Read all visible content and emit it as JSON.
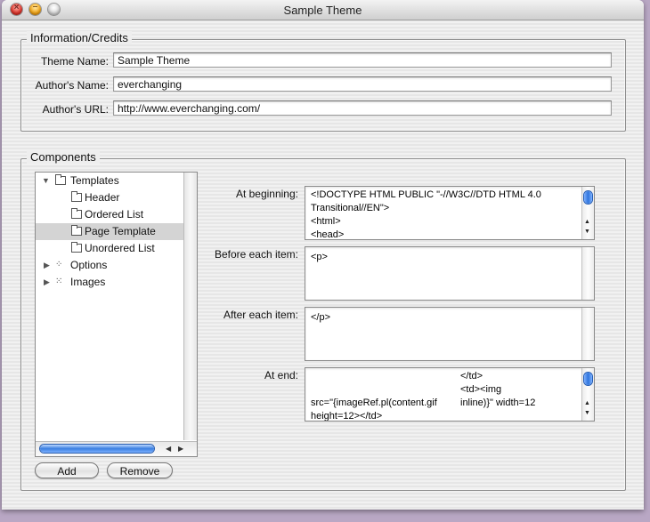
{
  "window": {
    "title": "Sample Theme"
  },
  "info": {
    "title": "Information/Credits",
    "theme_name_label": "Theme Name:",
    "theme_name_value": "Sample Theme",
    "author_name_label": "Author's Name:",
    "author_name_value": "everchanging",
    "author_url_label": "Author's URL:",
    "author_url_value": "http://www.everchanging.com/"
  },
  "components": {
    "title": "Components",
    "tree": [
      {
        "label": "Templates",
        "expanded": true,
        "icon": "folder-icon"
      },
      {
        "label": "Header",
        "icon": "folder-icon"
      },
      {
        "label": "Ordered List",
        "icon": "folder-icon"
      },
      {
        "label": "Page Template",
        "icon": "folder-icon",
        "selected": true
      },
      {
        "label": "Unordered List",
        "icon": "folder-icon"
      },
      {
        "label": "Options",
        "expanded": false,
        "icon": "options-icon"
      },
      {
        "label": "Images",
        "expanded": false,
        "icon": "images-icon"
      }
    ],
    "add_label": "Add",
    "remove_label": "Remove",
    "at_beginning_label": "At beginning:",
    "at_beginning_text": "<!DOCTYPE HTML PUBLIC \"-//W3C//DTD HTML 4.0\nTransitional//EN\">\n<html>\n<head>",
    "before_each_label": "Before each item:",
    "before_each_text": "<p>",
    "after_each_label": "After each item:",
    "after_each_text": "</p>",
    "at_end_label": "At end:",
    "at_end_col1": "\n\nsrc=\"{imageRef.pl(content.gif\nheight=12></td>",
    "at_end_col2": "</td>\n<td><img\ninline)}\" width=12"
  },
  "colors": {
    "accent": "#3a7fe0",
    "selection": "#d4d4d4"
  }
}
